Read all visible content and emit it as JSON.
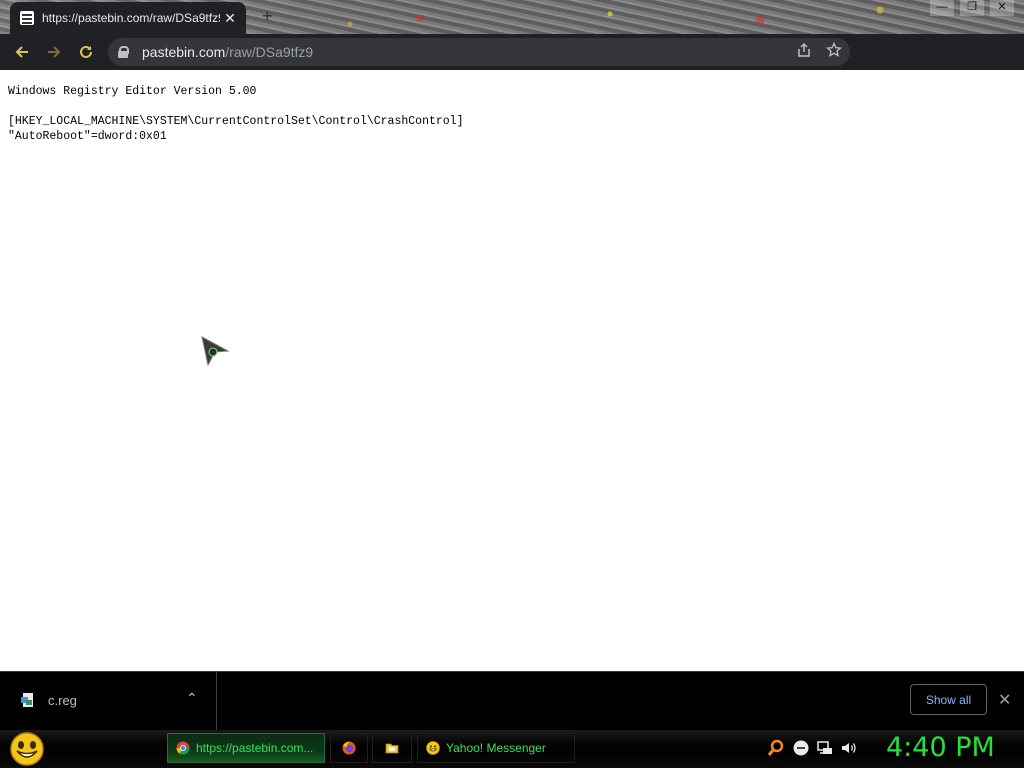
{
  "browser": {
    "tab": {
      "title": "https://pastebin.com/raw/DSa9tfz9",
      "close_glyph": "✕"
    },
    "new_tab_glyph": "+",
    "window_controls": {
      "minimize": "—",
      "maximize": "❐",
      "close": "✕"
    },
    "nav": {
      "back_icon": "arrow-left-icon",
      "forward_icon": "arrow-right-icon",
      "reload_icon": "reload-icon"
    },
    "address": {
      "host": "pastebin.com",
      "path": "/raw/DSa9tfz9"
    },
    "colors": {
      "accent": "#e0c350",
      "toolbar": "#202124",
      "omnibox": "#35363a"
    }
  },
  "page": {
    "lines": [
      "Windows Registry Editor Version 5.00",
      "",
      "[HKEY_LOCAL_MACHINE\\SYSTEM\\CurrentControlSet\\Control\\CrashControl]",
      "\"AutoReboot\"=dword:0x01"
    ]
  },
  "downloads": {
    "item": {
      "name": "c.reg",
      "chevron": "⌃"
    },
    "show_all_label": "Show all",
    "close_glyph": "✕"
  },
  "taskbar": {
    "tasks": [
      {
        "label": "https://pastebin.com...",
        "icon": "chrome-icon",
        "active": true
      },
      {
        "label": "",
        "icon": "firefox-icon",
        "active": false
      },
      {
        "label": "",
        "icon": "folder-icon",
        "active": false
      },
      {
        "label": "Yahoo! Messenger",
        "icon": "yahoo-messenger-icon",
        "active": false
      }
    ],
    "clock": "4:40 PM",
    "colors": {
      "text": "#39e05a",
      "clock": "#25e03c"
    }
  }
}
